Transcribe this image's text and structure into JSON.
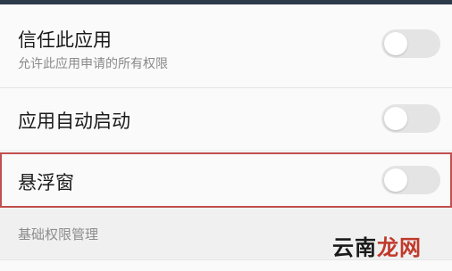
{
  "settings": [
    {
      "title": "信任此应用",
      "subtitle": "允许此应用申请的所有权限",
      "enabled": false
    },
    {
      "title": "应用自动启动",
      "enabled": false
    },
    {
      "title": "悬浮窗",
      "enabled": false
    }
  ],
  "section_header": "基础权限管理",
  "watermark": {
    "part1": "云南",
    "part2": "龙网"
  },
  "colors": {
    "highlight_border": "#c0504d",
    "toggle_off": "#e4e4e4",
    "top_bar": "#2d3a4a"
  }
}
